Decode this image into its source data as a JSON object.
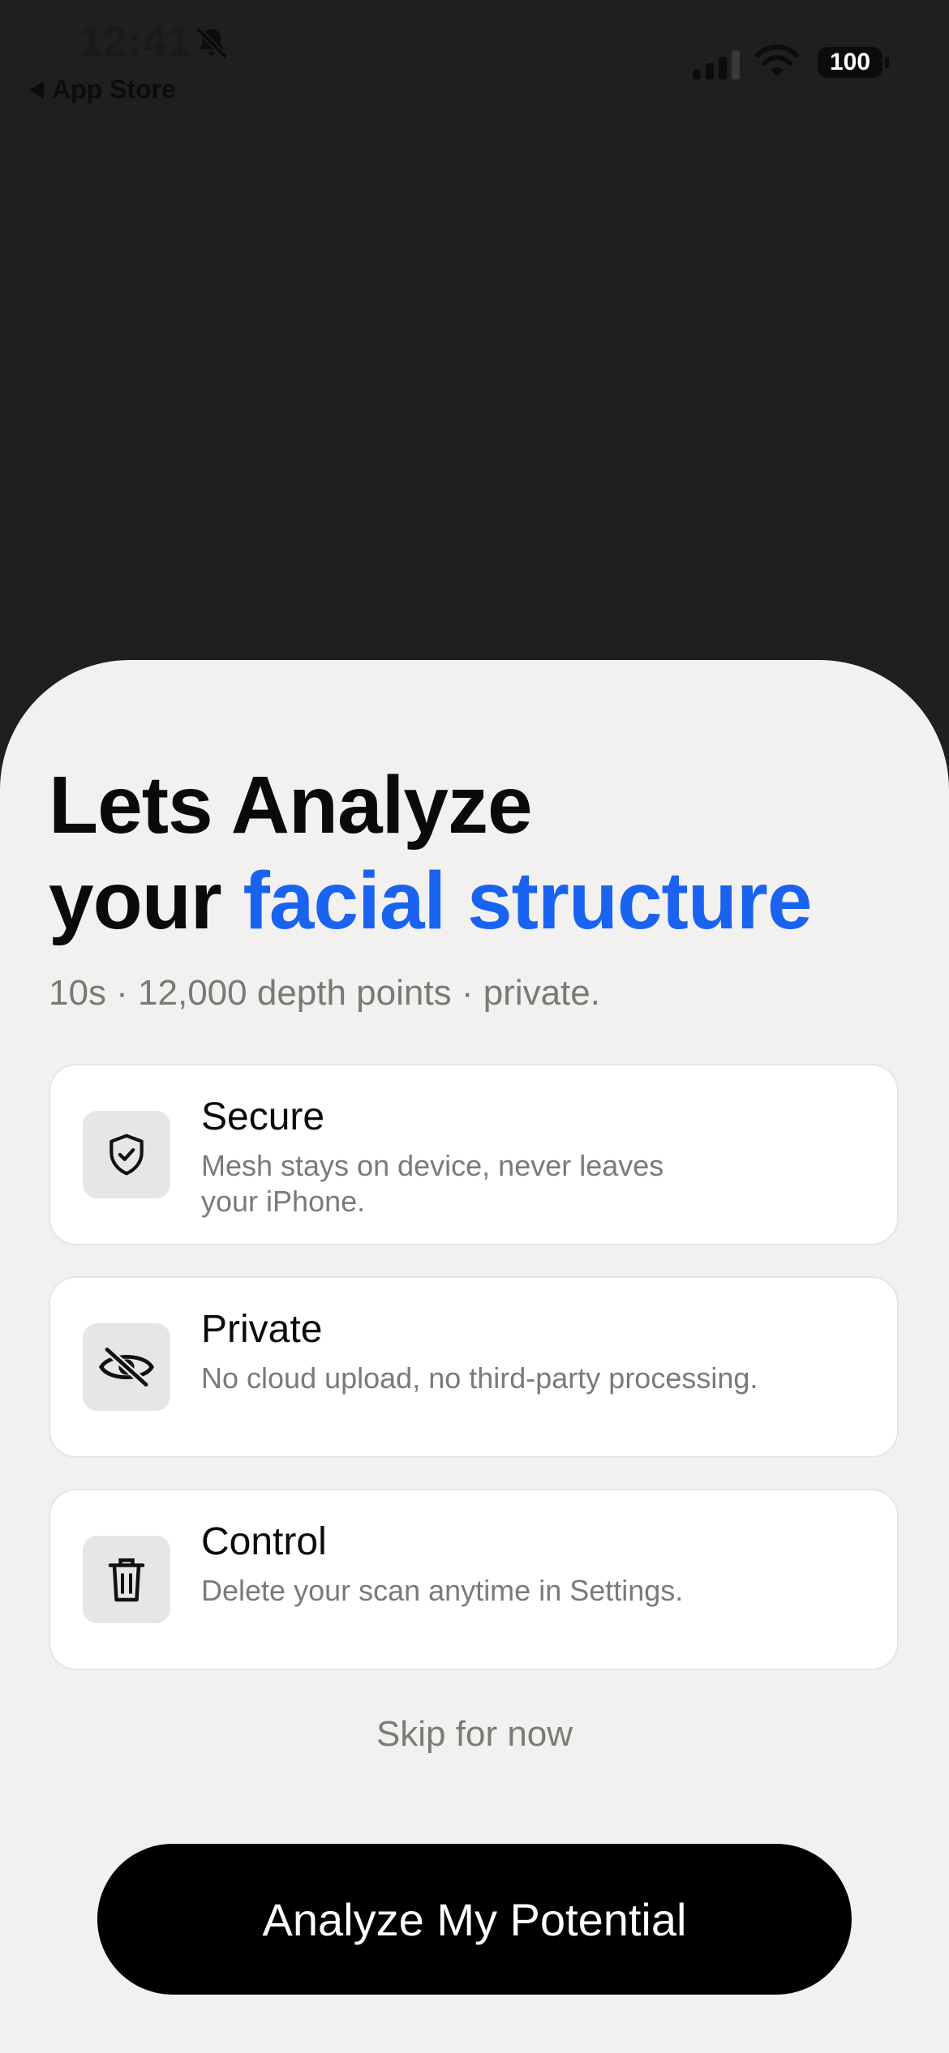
{
  "status_bar": {
    "time": "12:41",
    "back_label": "App Store",
    "battery": "100",
    "icons": [
      "bell-slash-icon",
      "cellular-signal-icon",
      "wifi-icon",
      "battery-icon"
    ]
  },
  "sheet": {
    "headline_line1": "Lets Analyze",
    "headline_line2_prefix": "your",
    "headline_line2_accent": "facial structure",
    "subtitle": "10s · 12,000 depth points · private.",
    "cards": [
      {
        "title": "Secure",
        "description": "Mesh stays on device, never leaves your iPhone.",
        "icon": "shield-check-icon"
      },
      {
        "title": "Private",
        "description": "No cloud upload, no third-party processing.",
        "icon": "eye-slash-icon"
      },
      {
        "title": "Control",
        "description": "Delete your scan anytime in Settings.",
        "icon": "trash-icon"
      }
    ],
    "skip_label": "Skip for now",
    "cta_label": "Analyze My Potential"
  },
  "colors": {
    "background_top": "#1f1f21",
    "sheet": "#f2f1ef",
    "accent": "#1a63f0",
    "cta": "#000000"
  }
}
